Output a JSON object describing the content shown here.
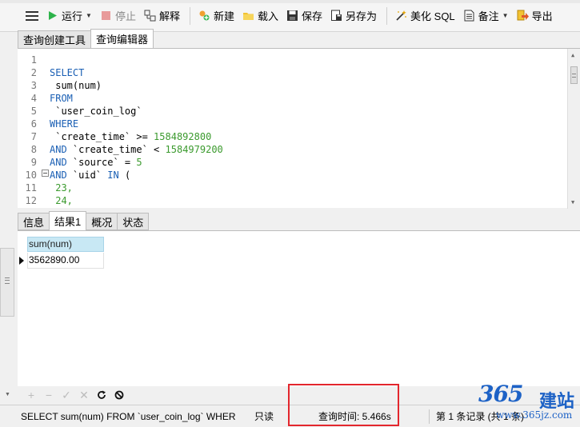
{
  "toolbar": {
    "run": "运行",
    "stop": "停止",
    "explain": "解释",
    "new": "新建",
    "load": "载入",
    "save": "保存",
    "save_as": "另存为",
    "beautify": "美化 SQL",
    "note": "备注",
    "export": "导出"
  },
  "tabs": [
    "查询创建工具",
    "查询编辑器"
  ],
  "editor": {
    "line_numbers": [
      "1",
      "2",
      "3",
      "4",
      "5",
      "6",
      "7",
      "8",
      "9",
      "10",
      "11",
      "12"
    ],
    "lines": [
      {
        "parts": []
      },
      {
        "parts": [
          {
            "t": "SELECT",
            "c": "kw"
          }
        ]
      },
      {
        "parts": [
          {
            "t": " sum(num)",
            "c": ""
          }
        ]
      },
      {
        "parts": [
          {
            "t": "FROM",
            "c": "kw"
          }
        ]
      },
      {
        "parts": [
          {
            "t": " `user_coin_log`",
            "c": ""
          }
        ]
      },
      {
        "parts": [
          {
            "t": "WHERE",
            "c": "kw"
          }
        ]
      },
      {
        "parts": [
          {
            "t": " `create_time` >= ",
            "c": ""
          },
          {
            "t": "1584892800",
            "c": "num"
          }
        ]
      },
      {
        "parts": [
          {
            "t": "AND",
            "c": "kw"
          },
          {
            "t": " `create_time` < ",
            "c": ""
          },
          {
            "t": "1584979200",
            "c": "num"
          }
        ]
      },
      {
        "parts": [
          {
            "t": "AND",
            "c": "kw"
          },
          {
            "t": " `source` = ",
            "c": ""
          },
          {
            "t": "5",
            "c": "num"
          }
        ]
      },
      {
        "parts": [
          {
            "t": "AND",
            "c": "kw"
          },
          {
            "t": " `uid` ",
            "c": ""
          },
          {
            "t": "IN",
            "c": "kw"
          },
          {
            "t": " (",
            "c": ""
          }
        ]
      },
      {
        "parts": [
          {
            "t": " 23,",
            "c": "num"
          }
        ]
      },
      {
        "parts": [
          {
            "t": " 24,",
            "c": "num"
          }
        ]
      }
    ]
  },
  "result_tabs": [
    "信息",
    "结果1",
    "概况",
    "状态"
  ],
  "result": {
    "column": "sum(num)",
    "value": "3562890.00"
  },
  "status": {
    "sql": "SELECT  sum(num) FROM  `user_coin_log`  WHER",
    "readonly": "只读",
    "query_time": "查询时间: 5.466s",
    "record": "第 1 条记录 (共 1 条)"
  },
  "watermark": {
    "brand": "365",
    "cn": "建站",
    "url": "www.365jz.com"
  },
  "colors": {
    "keyword": "#1a5fb4",
    "number": "#3b9a2e",
    "highlight": "#e3262d",
    "grid_header": "#c8e8f4"
  }
}
